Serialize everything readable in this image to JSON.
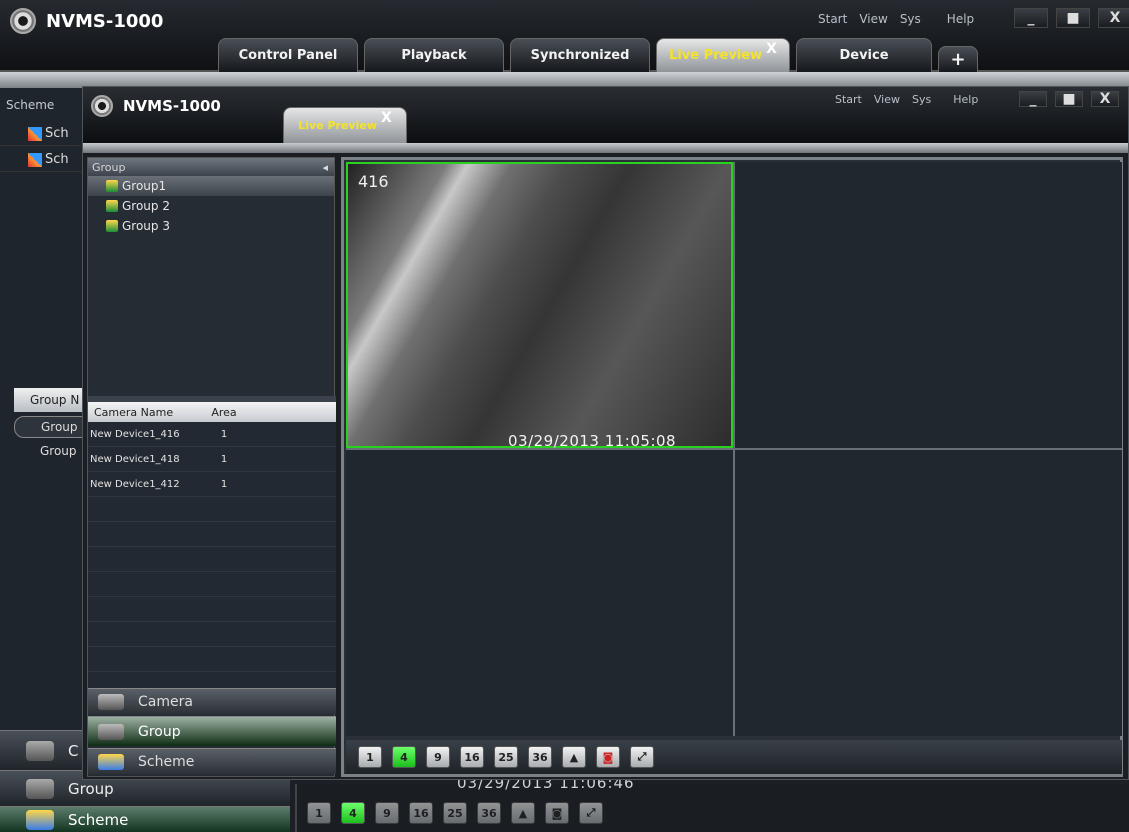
{
  "app": {
    "name": "NVMS-1000"
  },
  "outer": {
    "menu": [
      "Start",
      "View",
      "Sys",
      "Help"
    ],
    "tabs": [
      {
        "label": "Control Panel"
      },
      {
        "label": "Playback"
      },
      {
        "label": "Synchronized"
      },
      {
        "label": "Live Preview",
        "active": true,
        "close": "X"
      },
      {
        "label": "Device"
      }
    ],
    "add_tab": "+",
    "window_controls": [
      "_",
      "■",
      "X"
    ],
    "left": {
      "scheme_label": "Scheme",
      "scheme_items": [
        "Sch",
        "Sch"
      ],
      "group_table_header": "Group N",
      "group_rows": [
        "Group",
        "Group"
      ],
      "categories": [
        "C",
        "Group",
        "Scheme"
      ]
    },
    "bottom_bar": {
      "timestamp": "03/29/2013 11:06:46",
      "layout_buttons": [
        "1",
        "4",
        "9",
        "16",
        "25",
        "36"
      ]
    }
  },
  "inner": {
    "menu": [
      "Start",
      "View",
      "Sys",
      "Help"
    ],
    "tab": {
      "label": "Live Preview",
      "close": "X"
    },
    "window_controls": [
      "_",
      "■",
      "X"
    ],
    "group_panel": {
      "header": "Group",
      "items": [
        {
          "label": "Group1",
          "selected": true
        },
        {
          "label": "Group 2"
        },
        {
          "label": "Group 3"
        }
      ]
    },
    "camera_table": {
      "columns": [
        "Camera Name",
        "Area"
      ],
      "rows": [
        {
          "name": "New Device1_416",
          "area": "1"
        },
        {
          "name": "New Device1_418",
          "area": "1"
        },
        {
          "name": "New Device1_412",
          "area": "1"
        }
      ]
    },
    "categories": [
      {
        "label": "Camera"
      },
      {
        "label": "Group",
        "active": true
      },
      {
        "label": "Scheme"
      }
    ],
    "video": {
      "cells": [
        {
          "camera_id": "416",
          "timestamp": "03/29/2013 11:05:08",
          "active": true
        },
        {},
        {},
        {}
      ],
      "layout_buttons": [
        "1",
        "4",
        "9",
        "16",
        "25",
        "36"
      ],
      "active_layout": "4"
    }
  },
  "colors": {
    "active_tab_text": "#f5e32a",
    "selection_green": "#28d21e"
  },
  "icons": [
    "eye-logo-icon",
    "camera-icon",
    "group-icon",
    "scheme-icon",
    "snapshot-icon",
    "fullscreen-icon",
    "toggle-panel-icon"
  ]
}
